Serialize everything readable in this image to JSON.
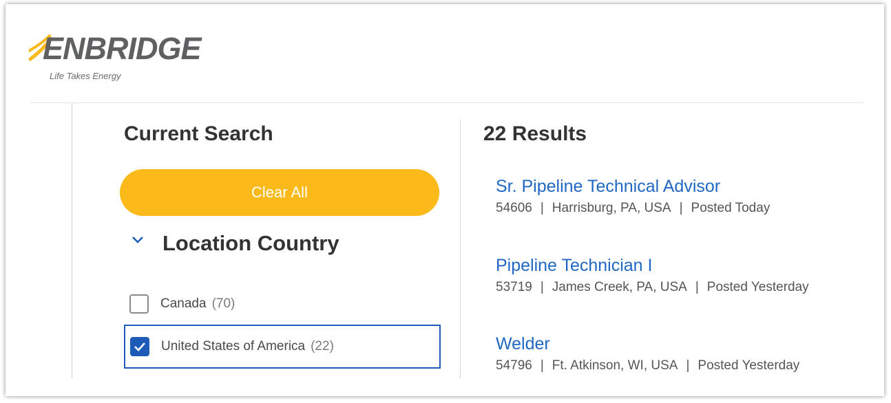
{
  "brand": {
    "name": "ENBRIDGE",
    "tagline": "Life Takes Energy",
    "colors": {
      "gray": "#5f6062",
      "gold": "#fbba1a"
    }
  },
  "left_panel": {
    "title": "Current Search",
    "clear_all_label": "Clear All",
    "facet_group": {
      "title": "Location Country",
      "icon": "chevron-down-icon",
      "options": [
        {
          "label": "Canada",
          "count": "(70)",
          "checked": false
        },
        {
          "label": "United States of America",
          "count": "(22)",
          "checked": true
        }
      ]
    }
  },
  "results": {
    "count_label": "22 Results",
    "jobs": [
      {
        "title": "Sr. Pipeline Technical Advisor",
        "id": "54606",
        "location": "Harrisburg, PA, USA",
        "posted": "Posted Today"
      },
      {
        "title": "Pipeline Technician I",
        "id": "53719",
        "location": "James Creek, PA, USA",
        "posted": "Posted Yesterday"
      },
      {
        "title": "Welder",
        "id": "54796",
        "location": "Ft. Atkinson, WI, USA",
        "posted": "Posted Yesterday"
      }
    ],
    "separator": "|"
  },
  "colors": {
    "accent": "#fbba1a",
    "link": "#2167c4",
    "checkbox_checked": "#1e5bb8",
    "heading": "#333333"
  }
}
